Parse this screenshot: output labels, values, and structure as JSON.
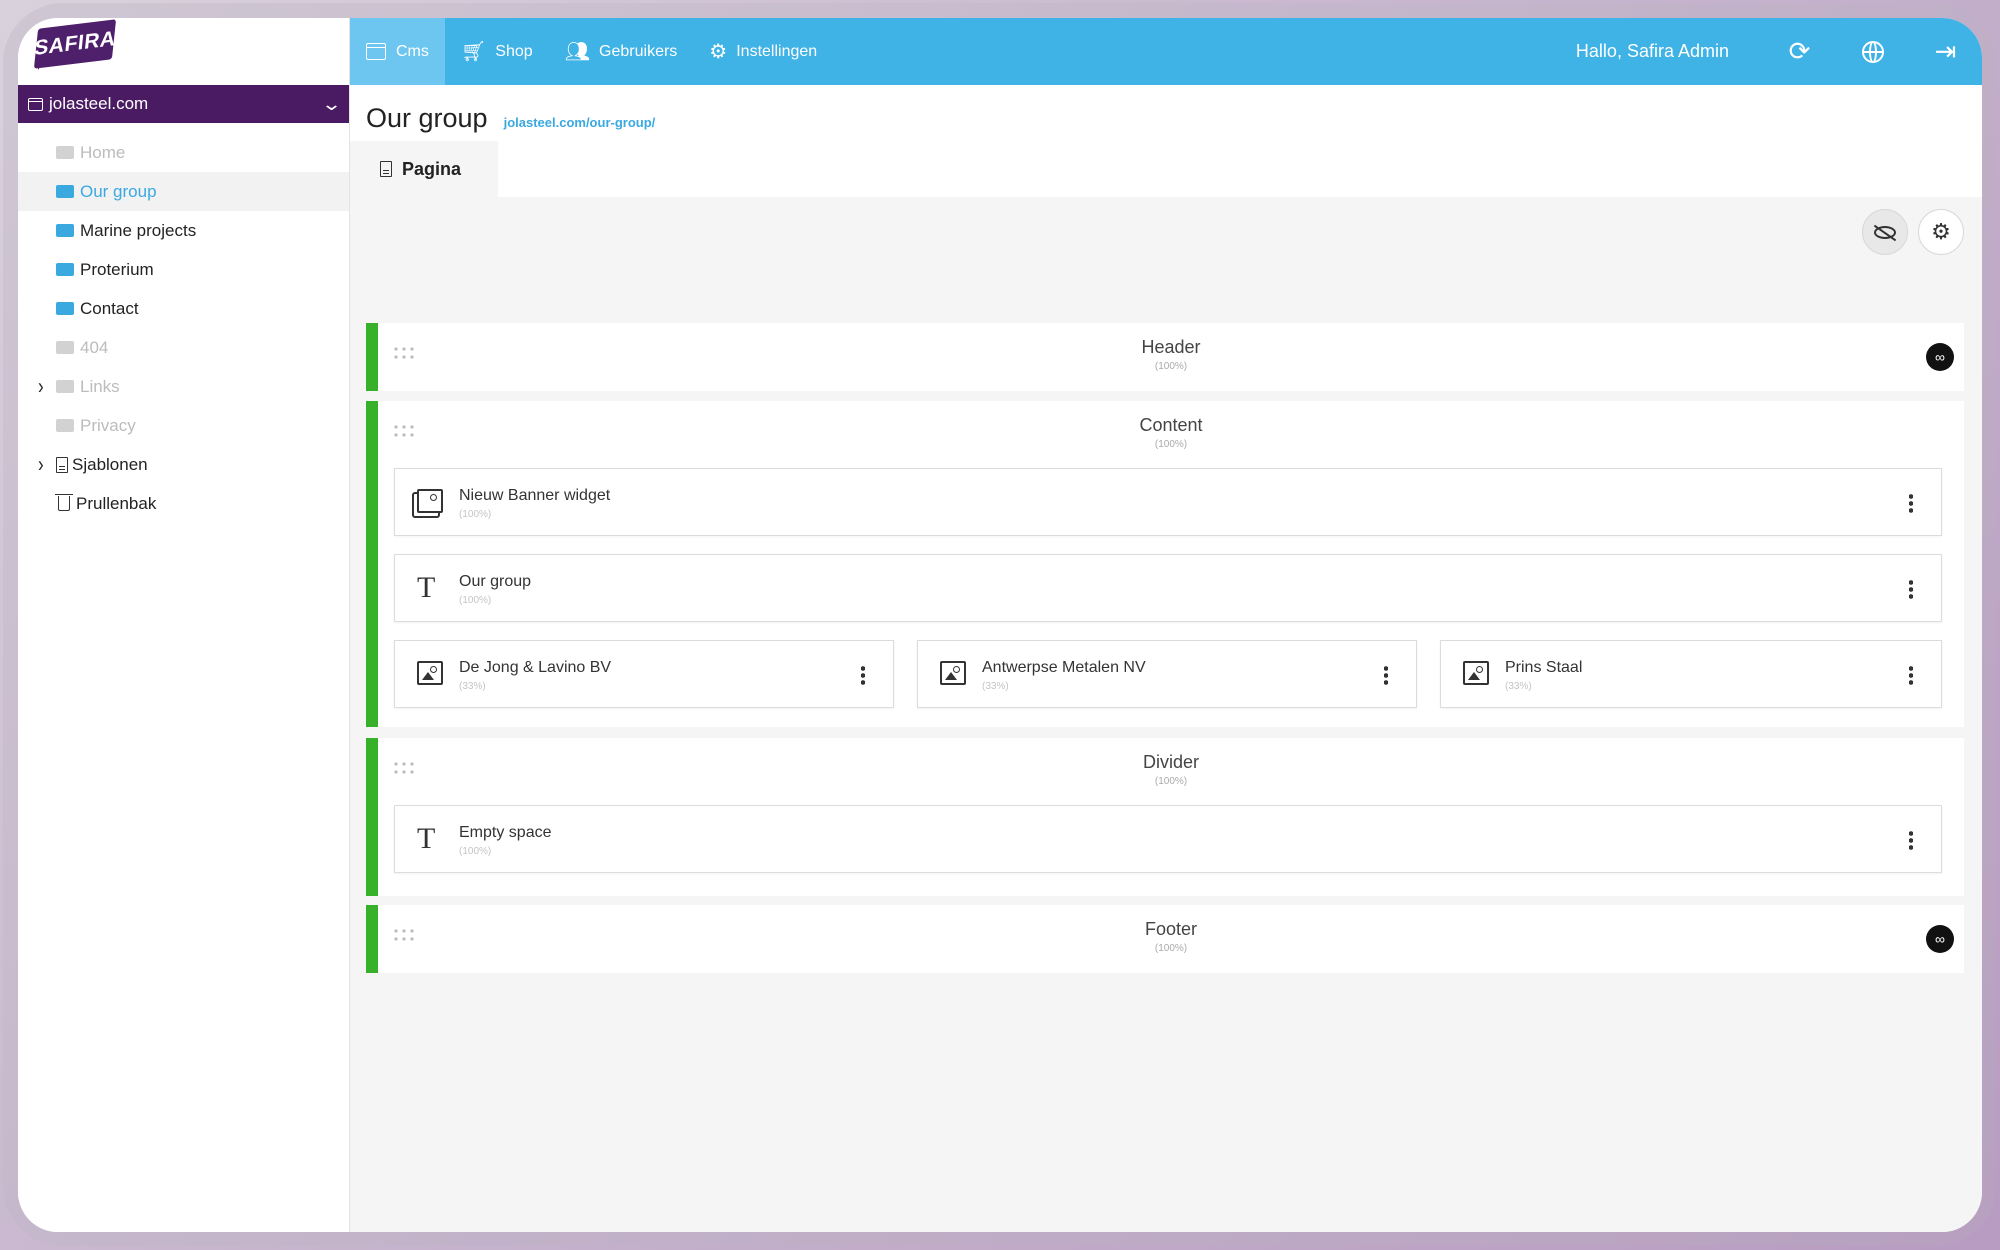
{
  "brand": {
    "logo_text": "SAFIRA"
  },
  "site_selector": {
    "label": "jolasteel.com"
  },
  "tree": [
    {
      "label": "Home",
      "state": "disabled"
    },
    {
      "label": "Our group",
      "state": "active"
    },
    {
      "label": "Marine projects",
      "state": "normal"
    },
    {
      "label": "Proterium",
      "state": "normal"
    },
    {
      "label": "Contact",
      "state": "normal"
    },
    {
      "label": "404",
      "state": "disabled"
    },
    {
      "label": "Links",
      "state": "disabled"
    },
    {
      "label": "Privacy",
      "state": "disabled"
    },
    {
      "label": "Sjablonen",
      "state": "normal"
    },
    {
      "label": "Prullenbak",
      "state": "normal"
    }
  ],
  "topnav": {
    "items": [
      {
        "label": "Cms",
        "icon": "window-icon"
      },
      {
        "label": "Shop",
        "icon": "cart-icon"
      },
      {
        "label": "Gebruikers",
        "icon": "users-icon"
      },
      {
        "label": "Instellingen",
        "icon": "gear-icon"
      }
    ],
    "greeting": "Hallo, Safira Admin"
  },
  "page": {
    "title": "Our group",
    "url": "jolasteel.com/our-group/",
    "tab": "Pagina"
  },
  "sections": {
    "header": {
      "title": "Header",
      "sub": "(100%)"
    },
    "content": {
      "title": "Content",
      "sub": "(100%)"
    },
    "divider": {
      "title": "Divider",
      "sub": "(100%)"
    },
    "footer": {
      "title": "Footer",
      "sub": "(100%)"
    }
  },
  "widgets": {
    "banner": {
      "title": "Nieuw Banner widget",
      "sub": "(100%)"
    },
    "text_our_group": {
      "title": "Our group",
      "sub": "(100%)"
    },
    "img1": {
      "title": "De Jong & Lavino BV",
      "sub": "(33%)"
    },
    "img2": {
      "title": "Antwerpse Metalen NV",
      "sub": "(33%)"
    },
    "img3": {
      "title": "Prins Staal",
      "sub": "(33%)"
    },
    "empty_space": {
      "title": "Empty space",
      "sub": "(100%)"
    }
  },
  "colors": {
    "topbar": "#3fb2e6",
    "site_selector": "#4a1b63",
    "accent": "#3aa9e0",
    "section_bar": "#38b12a"
  }
}
